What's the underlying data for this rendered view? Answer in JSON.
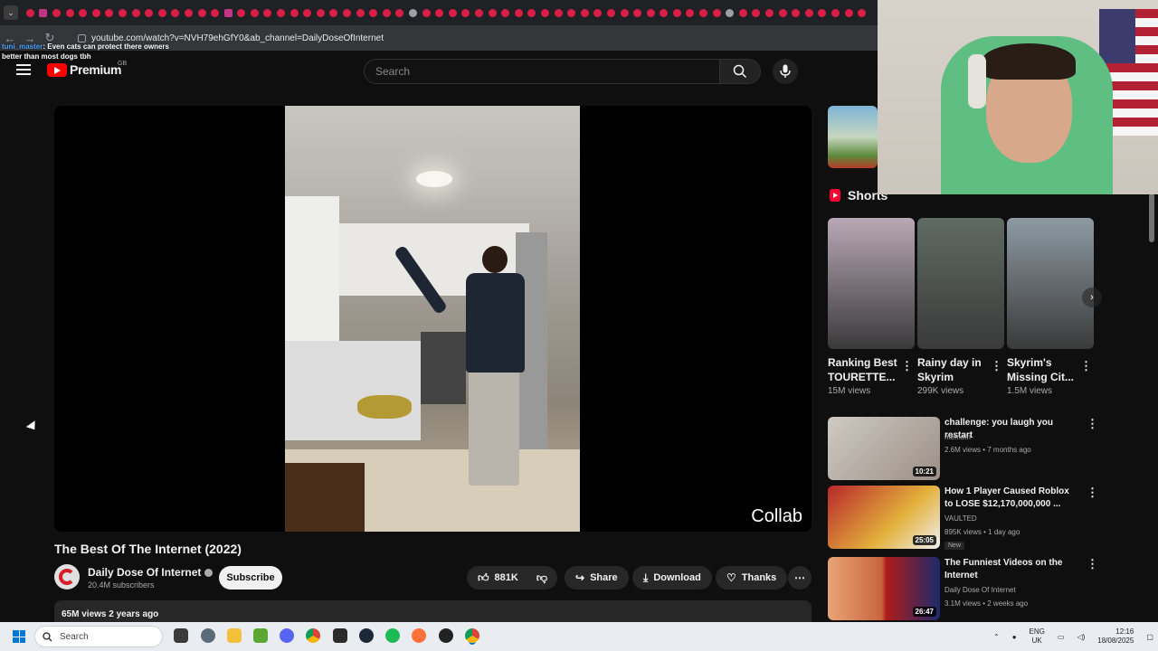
{
  "browser": {
    "url": "youtube.com/watch?v=NVH79ehGfY0&ab_channel=DailyDoseOfInternet"
  },
  "stream_overlay": {
    "chat_user": "tuni_master",
    "chat_message_line1": ": Even cats can protect there owners",
    "chat_message_line2": "better than most dogs tbh"
  },
  "header": {
    "logo_text": "Premium",
    "region": "GB",
    "search_placeholder": "Search"
  },
  "player": {
    "overlay_text": "Collab"
  },
  "video": {
    "title": "The Best Of The Internet (2022)",
    "channel_name": "Daily Dose Of Internet",
    "subscribers": "20.4M subscribers",
    "subscribe_label": "Subscribe",
    "likes": "881K",
    "share_label": "Share",
    "download_label": "Download",
    "thanks_label": "Thanks",
    "views_date": "65M views  2 years ago"
  },
  "sidebar": {
    "shorts_heading": "Shorts",
    "shorts": [
      {
        "title": "Ranking Best TOURETTE...",
        "views": "15M views",
        "thumb_color": "#b9a8b6"
      },
      {
        "title": "Rainy day in Skyrim",
        "views": "299K views",
        "thumb_color": "#5f6b63"
      },
      {
        "title": "Skyrim's Missing Cit...",
        "views": "1.5M views",
        "thumb_color": "#8d9aa3"
      }
    ],
    "recommendations": [
      {
        "title": "challenge: you laugh you restart",
        "channel": "memom",
        "meta": "2.6M views • 7 months ago",
        "duration": "10:21",
        "badge": ""
      },
      {
        "title": "How 1 Player Caused Roblox to LOSE $12,170,000,000 ...",
        "channel": "VAULTED",
        "meta": "895K views • 1 day ago",
        "duration": "25:05",
        "badge": "New"
      },
      {
        "title": "The Funniest Videos on the Internet",
        "channel": "Daily Dose Of Internet",
        "meta": "3.1M views • 2 weeks ago",
        "duration": "26:47",
        "badge": ""
      }
    ]
  },
  "taskbar": {
    "search_label": "Search",
    "language": "ENG",
    "region": "UK",
    "time": "12:16",
    "date": "18/08/2025"
  }
}
